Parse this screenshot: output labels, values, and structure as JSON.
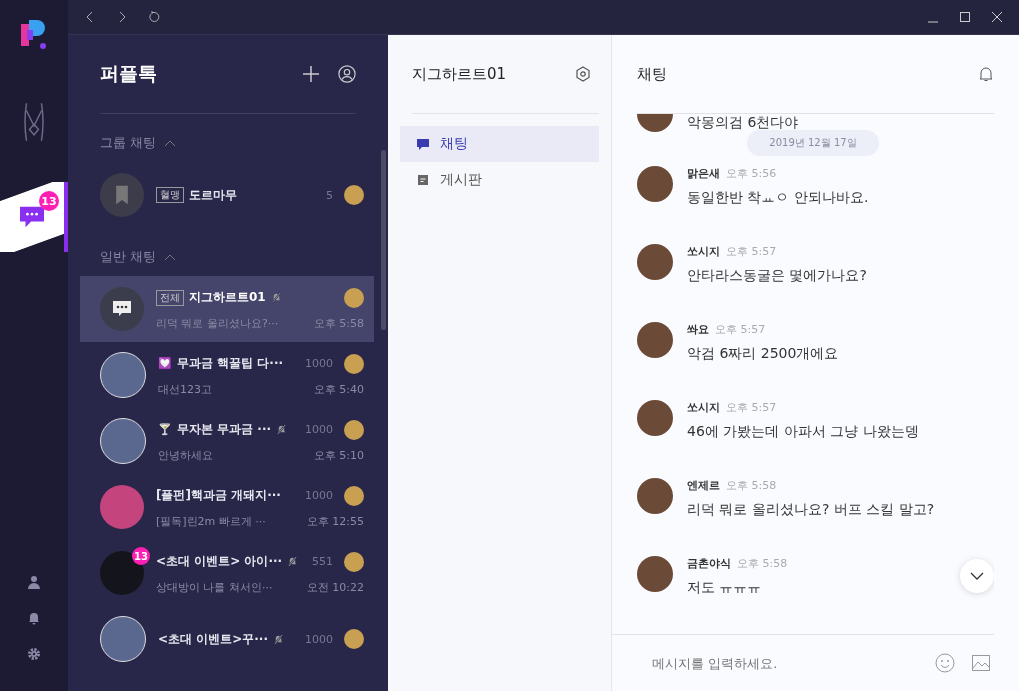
{
  "rail": {
    "badge": "13"
  },
  "list_panel": {
    "title": "퍼플톡",
    "sections": [
      {
        "title": "그룹 채팅",
        "expanded": true,
        "rooms": [
          {
            "tag": "혈맹",
            "name": "도르마무",
            "count": "5",
            "muted": false,
            "selected": false,
            "kind": "banner"
          }
        ]
      },
      {
        "title": "일반 채팅",
        "expanded": true,
        "rooms": [
          {
            "tag": "전체",
            "name": "지그하르트01",
            "muted": true,
            "selected": true,
            "last": "리덕 뭐로 올리셨나요?···",
            "time": "오후 5:58",
            "kind": "chat"
          },
          {
            "emoji": "💟",
            "name": "무과금 핵꿀팁 다···",
            "count": "1000",
            "muted": false,
            "selected": false,
            "last": "대선123고",
            "time": "오후 5:40",
            "kind": "photo"
          },
          {
            "emoji": "🍸",
            "name": "무자본 무과금 ···",
            "count": "1000",
            "muted": true,
            "selected": false,
            "last": "안녕하세요",
            "time": "오후 5:10",
            "kind": "photo"
          },
          {
            "name": "[플펀]핵과금 개돼지···",
            "count": "1000",
            "muted": false,
            "selected": false,
            "last": "[필독]린2m 빠르게 ···",
            "time": "오후 12:55",
            "kind": "pink"
          },
          {
            "name": "<초대 이벤트> 아이···",
            "count": "551",
            "muted": true,
            "selected": false,
            "badge": "13",
            "last": "상대방이 나를 쳐서인···",
            "time": "오전 10:22",
            "kind": "dark"
          },
          {
            "name": "<초대 이벤트>꾸···",
            "count": "1000",
            "muted": true,
            "selected": false,
            "kind": "photo"
          }
        ]
      }
    ]
  },
  "room_panel": {
    "title": "지그하르트01",
    "menu": [
      {
        "label": "채팅",
        "kind": "chat",
        "selected": true
      },
      {
        "label": "게시판",
        "kind": "board",
        "selected": false
      }
    ]
  },
  "chat": {
    "title": "채팅",
    "date": "2019년 12월 17일",
    "first_text": "악몽의검 6천다야",
    "messages": [
      {
        "author": "맑은새",
        "time": "오후 5:56",
        "text": "동일한반  착ㅛㅇ  안되나바요."
      },
      {
        "author": "쏘시지",
        "time": "오후 5:57",
        "text": "안타라스동굴은 몇에가나요?"
      },
      {
        "author": "쏴요",
        "time": "오후 5:57",
        "text": "악검 6짜리 2500개에요"
      },
      {
        "author": "쏘시지",
        "time": "오후 5:57",
        "text": "46에 가봤는데 아파서 그냥 나왔는뎅"
      },
      {
        "author": "엔제르",
        "time": "오후 5:58",
        "text": "리덕 뭐로 올리셨나요? 버프 스킬 말고?"
      },
      {
        "author": "금촌야식",
        "time": "오후 5:58",
        "text": "저도 ㅠㅠㅠ"
      }
    ],
    "input": {
      "placeholder": "메시지를 입력하세요."
    }
  }
}
